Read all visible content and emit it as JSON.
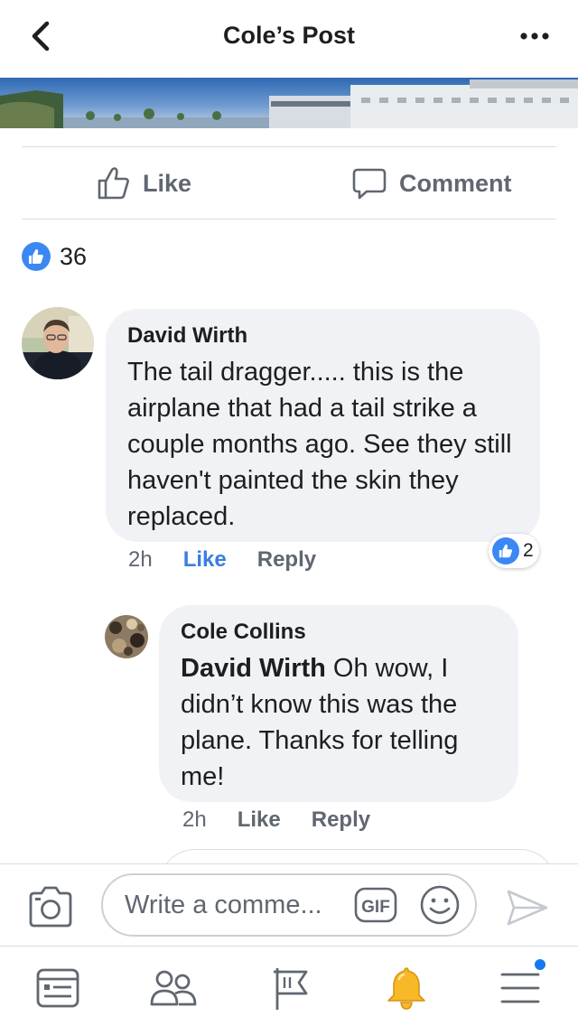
{
  "header": {
    "title": "Cole’s Post",
    "back_icon": "chevron-left-icon",
    "more_icon": "more-dots-icon"
  },
  "actions": {
    "like_label": "Like",
    "comment_label": "Comment"
  },
  "reactions": {
    "count": "36",
    "icon": "thumbs-up-icon"
  },
  "comments": [
    {
      "author": "David Wirth",
      "text": "The tail dragger..... this is the airplane that had a tail strike a couple months ago. See they still haven't painted the skin they replaced.",
      "time": "2h",
      "like_label": "Like",
      "reply_label": "Reply",
      "reaction_count": "2",
      "liked": true
    },
    {
      "author": "Cole Collins",
      "mention": "David Wirth",
      "text": " Oh wow, I didn’t know this was the plane. Thanks for telling me!",
      "time": "2h",
      "like_label": "Like",
      "reply_label": "Reply",
      "liked": false
    }
  ],
  "composer": {
    "placeholder": "Write a comme...",
    "gif_label": "GIF"
  },
  "tabs": [
    {
      "icon": "news-feed-icon"
    },
    {
      "icon": "friends-icon"
    },
    {
      "icon": "pages-flag-icon"
    },
    {
      "icon": "notifications-bell-icon"
    },
    {
      "icon": "menu-icon",
      "has_badge": true
    }
  ],
  "colors": {
    "accent": "#1877f2",
    "like_blue": "#3b88f5",
    "text_secondary": "#606770",
    "bubble_bg": "#f0f2f5",
    "bell_yellow": "#f7b928"
  }
}
